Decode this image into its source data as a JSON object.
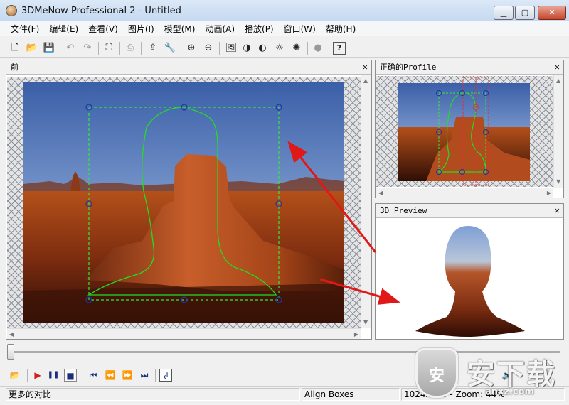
{
  "window": {
    "title": "3DMeNow Professional 2 - Untitled",
    "min_glyph": "▁",
    "max_glyph": "▢",
    "close_glyph": "✕"
  },
  "menu": [
    "文件(F)",
    "编辑(E)",
    "查看(V)",
    "图片(I)",
    "模型(M)",
    "动画(A)",
    "播放(P)",
    "窗口(W)",
    "帮助(H)"
  ],
  "toolbar": {
    "icons": [
      "new-file-icon",
      "open-folder-icon",
      "save-icon",
      "undo-icon",
      "redo-icon",
      "crop-frame-icon",
      "print-icon",
      "export-icon",
      "wrench-icon",
      "zoom-in-icon",
      "zoom-out-icon",
      "image-icon",
      "contrast-icon",
      "tone-icon",
      "brightness-icon",
      "brightness-alt-icon",
      "record-dot-icon",
      "help-icon"
    ],
    "glyphs": {
      "new": "🗋",
      "open": "📂",
      "save": "💾",
      "undo": "↶",
      "redo": "↷",
      "crop": "⛶",
      "print": "⎙",
      "export": "⇪",
      "wrench": "🔧",
      "zoom_in": "⊕",
      "zoom_out": "⊖",
      "image": "🖼",
      "contrast": "◑",
      "tone": "◐",
      "bright": "☼",
      "bright2": "✺",
      "dot": "●",
      "help": "?"
    }
  },
  "panels": {
    "front": {
      "title": "前",
      "close": "✕"
    },
    "profile": {
      "title": "正确的Profile",
      "close": "✕"
    },
    "preview": {
      "title": "3D Preview",
      "close": "✕"
    }
  },
  "playback": {
    "glyphs": {
      "open": "📂",
      "record": "▶",
      "pause": "❚❚",
      "stop": "■",
      "first": "⏮",
      "rewind": "⏪",
      "forward": "⏩",
      "last": "⏭",
      "loop": "↲",
      "speaker": "🔈"
    },
    "timeline_position": 0.0
  },
  "status": {
    "message": "更多的对比",
    "mode": "Align Boxes",
    "info": "1024x768 - Zoom: 44%"
  },
  "watermark": {
    "shield": "安",
    "text": "安下载",
    "domain": "anxz.com"
  },
  "colors": {
    "guide_box": "#39e639",
    "silhouette": "#22dd22",
    "handle": "#2233aa",
    "profile_guide": "#e03030",
    "arrow": "#e01818"
  }
}
